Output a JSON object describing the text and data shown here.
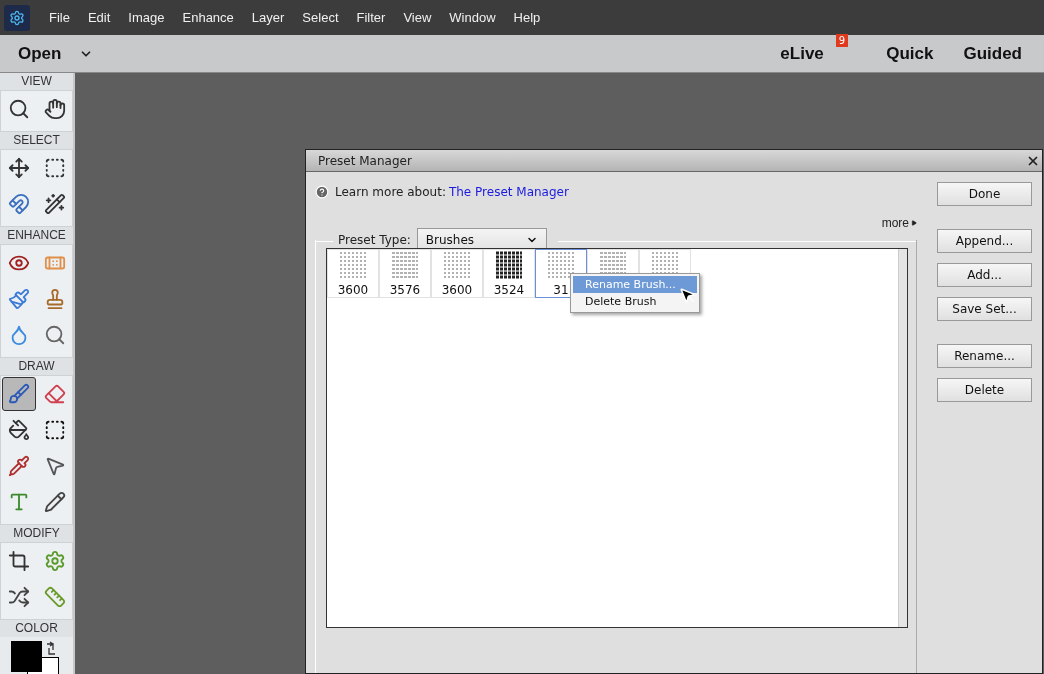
{
  "menu_bar": {
    "items": [
      "File",
      "Edit",
      "Image",
      "Enhance",
      "Layer",
      "Select",
      "Filter",
      "View",
      "Window",
      "Help"
    ]
  },
  "mode_bar": {
    "open": "Open",
    "elive": "eLive",
    "elive_badge": "9",
    "modes": [
      {
        "label": "Quick",
        "selected": false
      },
      {
        "label": "Guided",
        "selected": false
      }
    ]
  },
  "toolbox": {
    "sections": [
      {
        "label": "VIEW",
        "tools": [
          {
            "kind": "zoom",
            "selected": false
          },
          {
            "kind": "hand",
            "selected": false
          }
        ]
      },
      {
        "label": "SELECT",
        "tools": [
          {
            "kind": "move",
            "selected": false
          },
          {
            "kind": "marquee",
            "selected": false
          },
          {
            "kind": "lasso",
            "selected": false
          },
          {
            "kind": "wand",
            "selected": false
          }
        ]
      },
      {
        "label": "ENHANCE",
        "tools": [
          {
            "kind": "eye",
            "selected": false
          },
          {
            "kind": "bandage",
            "selected": false
          },
          {
            "kind": "smart-brush",
            "selected": false
          },
          {
            "kind": "stamp",
            "selected": false
          },
          {
            "kind": "drop",
            "selected": false
          },
          {
            "kind": "sponge",
            "selected": false
          }
        ]
      },
      {
        "label": "DRAW",
        "tools": [
          {
            "kind": "brush",
            "selected": true
          },
          {
            "kind": "eraser",
            "selected": false
          },
          {
            "kind": "bucket",
            "selected": false
          },
          {
            "kind": "gradient",
            "selected": false
          },
          {
            "kind": "eyedropper",
            "selected": false
          },
          {
            "kind": "pointer",
            "selected": false
          },
          {
            "kind": "type",
            "selected": false
          },
          {
            "kind": "pencil",
            "selected": false
          }
        ]
      },
      {
        "label": "MODIFY",
        "tools": [
          {
            "kind": "crop",
            "selected": false
          },
          {
            "kind": "recompose",
            "selected": false
          },
          {
            "kind": "shuffle",
            "selected": false
          },
          {
            "kind": "straighten",
            "selected": false
          }
        ]
      },
      {
        "label": "COLOR"
      }
    ]
  },
  "dialog": {
    "title": "Preset Manager",
    "help_text": "Learn more about:",
    "help_link": "The Preset Manager",
    "preset_type_label": "Preset Type:",
    "preset_type_value": "Brushes",
    "more": "more",
    "thumbnails": [
      {
        "label": "3600",
        "selected": false
      },
      {
        "label": "3576",
        "selected": false
      },
      {
        "label": "3600",
        "selected": false
      },
      {
        "label": "3524",
        "selected": false
      },
      {
        "label": "31",
        "selected": true
      },
      {
        "selected": false
      },
      {
        "selected": false
      }
    ],
    "context_menu": [
      {
        "label": "Rename Brush...",
        "selected": true
      },
      {
        "label": "Delete Brush",
        "selected": false
      }
    ],
    "button_groups": [
      [
        "Done"
      ],
      [
        "Append...",
        "Add...",
        "Save Set..."
      ],
      [
        "Rename...",
        "Delete"
      ]
    ]
  }
}
